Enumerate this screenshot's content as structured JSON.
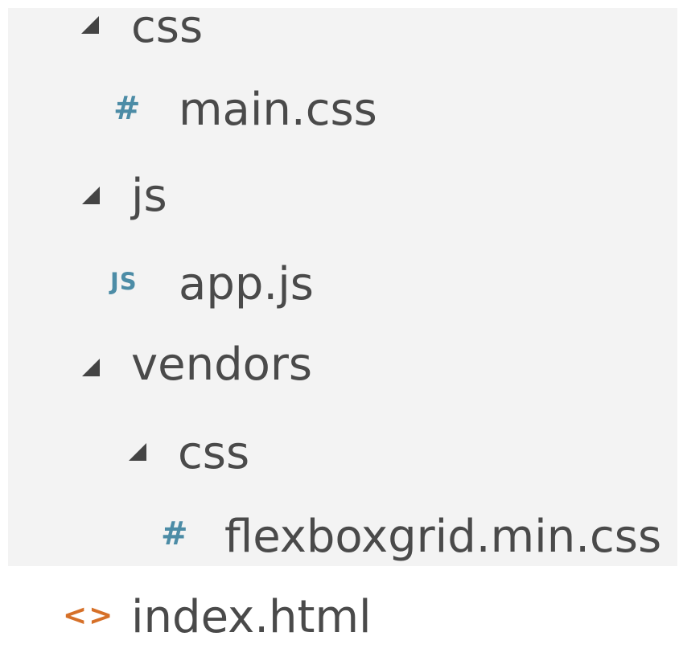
{
  "tree": {
    "items": [
      {
        "kind": "folder",
        "label": "css",
        "icon": "chevron-expanded-icon"
      },
      {
        "kind": "file",
        "label": "main.css",
        "icon_text": "#",
        "icon": "css-file-icon"
      },
      {
        "kind": "folder",
        "label": "js",
        "icon": "chevron-expanded-icon"
      },
      {
        "kind": "file",
        "label": "app.js",
        "icon_text": "JS",
        "icon": "js-file-icon"
      },
      {
        "kind": "folder",
        "label": "vendors",
        "icon": "chevron-expanded-icon"
      },
      {
        "kind": "folder",
        "label": "css",
        "icon": "chevron-expanded-icon"
      },
      {
        "kind": "file",
        "label": "flexboxgrid.min.css",
        "icon_text": "#",
        "icon": "css-file-icon"
      },
      {
        "kind": "file",
        "label": "index.html",
        "icon_text": "<>",
        "icon": "html-file-icon"
      }
    ]
  },
  "colors": {
    "panel_background": "#f3f3f3",
    "text": "#4a4a4a",
    "twisty": "#444444",
    "css_icon": "#4c8ca6",
    "js_icon": "#4c8ca6",
    "html_icon": "#d67028"
  }
}
